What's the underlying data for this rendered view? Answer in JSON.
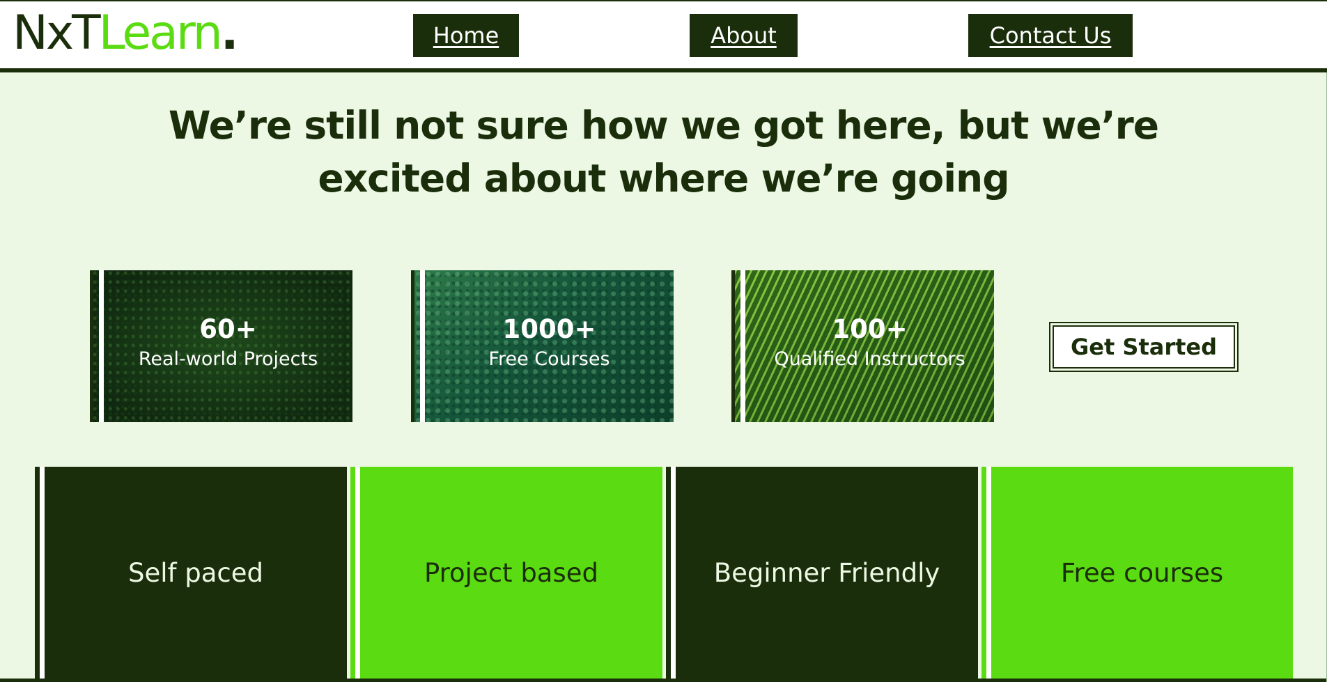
{
  "header": {
    "logo": {
      "part1": "NxT",
      "part2": "Learn",
      "part3": "."
    },
    "nav": [
      {
        "label": "Home"
      },
      {
        "label": "About"
      },
      {
        "label": "Contact Us"
      }
    ]
  },
  "hero": {
    "heading": "We’re still not sure how we got here, but we’re excited about where we’re going"
  },
  "stats": [
    {
      "value": "60+",
      "label": "Real-world Projects"
    },
    {
      "value": "1000+",
      "label": "Free Courses"
    },
    {
      "value": "100+",
      "label": "Qualified Instructors"
    }
  ],
  "cta": {
    "label": "Get Started"
  },
  "features": [
    {
      "label": "Self paced"
    },
    {
      "label": "Project based"
    },
    {
      "label": "Beginner Friendly"
    },
    {
      "label": "Free courses"
    }
  ],
  "colors": {
    "dark_green": "#1b2e0b",
    "bright_green": "#5bdb12",
    "page_background": "#edf8e4",
    "white": "#ffffff"
  }
}
